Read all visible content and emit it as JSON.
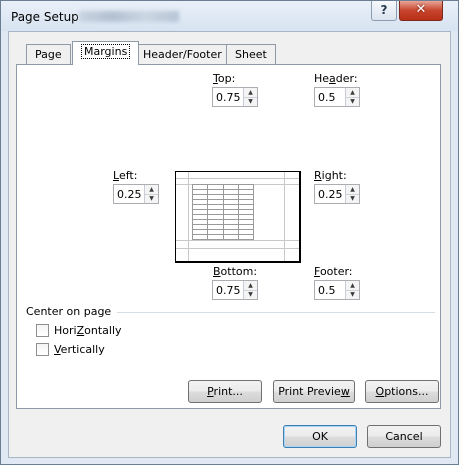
{
  "window": {
    "title": "Page Setup",
    "help_label": "?",
    "close_label": "✕"
  },
  "tabs": [
    {
      "label": "Page",
      "active": false
    },
    {
      "label": "Margins",
      "active": true
    },
    {
      "label": "Header/Footer",
      "active": false
    },
    {
      "label": "Sheet",
      "active": false
    }
  ],
  "margins": {
    "top": {
      "label_mnemonic": "T",
      "label_rest": "op:",
      "value": "0.75"
    },
    "header": {
      "label_pre": "He",
      "label_mnemonic": "a",
      "label_rest": "der:",
      "value": "0.5"
    },
    "left": {
      "label_mnemonic": "L",
      "label_rest": "eft:",
      "value": "0.25"
    },
    "right": {
      "label_mnemonic": "R",
      "label_rest": "ight:",
      "value": "0.25"
    },
    "bottom": {
      "label_mnemonic": "B",
      "label_rest": "ottom:",
      "value": "0.75"
    },
    "footer": {
      "label_mnemonic": "F",
      "label_rest": "ooter:",
      "value": "0.5"
    }
  },
  "spin_icons": {
    "up": "spin-up-icon",
    "down": "spin-down-icon"
  },
  "center_on_page": {
    "label": "Center on page",
    "horizontally": {
      "label_mnemonic": "Z",
      "label_pre": "Hori",
      "label_rest": "ontally",
      "checked": false
    },
    "vertically": {
      "label_mnemonic": "V",
      "label_rest": "ertically",
      "checked": false
    }
  },
  "buttons": {
    "print": {
      "label_mnemonic": "P",
      "label_rest": "rint..."
    },
    "print_preview": {
      "label_pre": "Print Previe",
      "label_mnemonic": "w",
      "label_rest": ""
    },
    "options": {
      "label_mnemonic": "O",
      "label_rest": "ptions..."
    },
    "ok": "OK",
    "cancel": "Cancel"
  },
  "colors": {
    "title_bg": "#dfe8f3",
    "close_button": "#c7452d",
    "default_button_border": "#3c7fb1"
  }
}
